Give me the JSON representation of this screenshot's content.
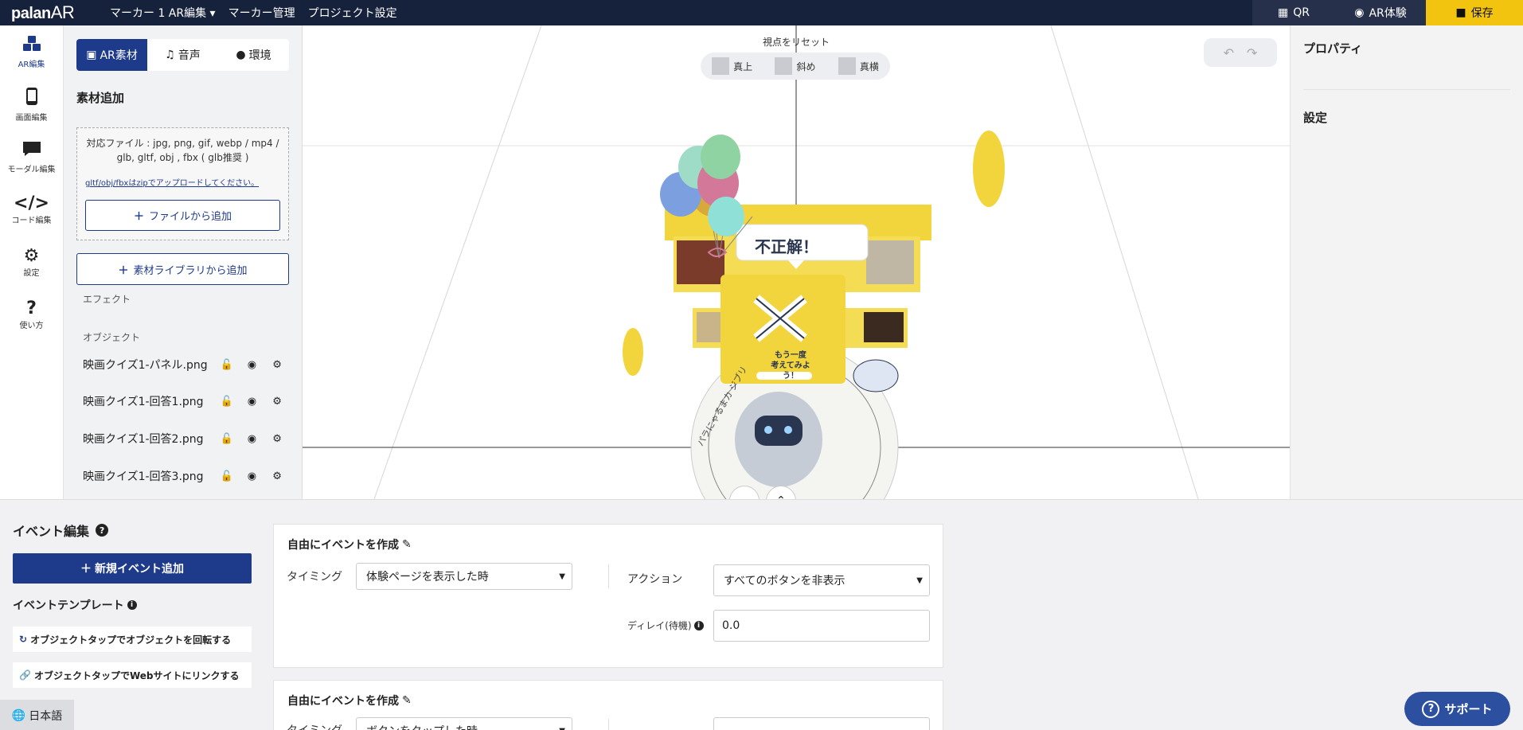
{
  "header": {
    "logo": "palan",
    "logo_ar": "AR",
    "nav": [
      "マーカー 1 AR編集 ▾",
      "マーカー管理",
      "プロジェクト設定"
    ],
    "qr_label": "QR",
    "ar_experience_label": "AR体験",
    "save_label": "保存"
  },
  "rail": {
    "items": [
      {
        "label": "AR編集",
        "icon": "cubes-icon"
      },
      {
        "label": "画面編集",
        "icon": "mobile-icon"
      },
      {
        "label": "モーダル編集",
        "icon": "comment-icon"
      },
      {
        "label": "コード編集",
        "icon": "code-icon"
      },
      {
        "label": "設定",
        "icon": "gear-icon"
      },
      {
        "label": "使い方",
        "icon": "question-icon"
      }
    ]
  },
  "panel": {
    "tabs": [
      {
        "label": "AR素材",
        "icon": "cubes-icon"
      },
      {
        "label": "音声",
        "icon": "music-icon"
      },
      {
        "label": "環境",
        "icon": "bulb-icon"
      }
    ],
    "title": "素材追加",
    "formats_line1": "対応ファイル : jpg, png, gif, webp / mp4 /",
    "formats_line2": "glb, gltf, obj , fbx ( glb推奨 )",
    "zip_note": "gltf/obj/fbxはzipでアップロードしてください。",
    "add_file": "ファイルから追加",
    "add_library": "素材ライブラリから追加",
    "effect_label": "エフェクト",
    "object_label": "オブジェクト",
    "objects": [
      "映画クイズ1-パネル.png",
      "映画クイズ1-回答1.png",
      "映画クイズ1-回答2.png",
      "映画クイズ1-回答3.png"
    ]
  },
  "viewport": {
    "reset": "視点をリセット",
    "views": [
      "真上",
      "斜め",
      "真横"
    ],
    "panel_text": "不正解！",
    "retry_text_1": "もう一度",
    "retry_text_2": "考えてみよう！",
    "circle_text": "パラにゃるまカ ジブリ"
  },
  "properties": {
    "title": "プロパティ",
    "settings": "設定"
  },
  "events": {
    "title": "イベント編集",
    "new_event": "新規イベント追加",
    "template_title": "イベントテンプレート",
    "templates": [
      "オブジェクトタップでオブジェクトを回転する",
      "オブジェクトタップでWebサイトにリンクする"
    ],
    "language": "日本語",
    "cards": [
      {
        "title": "自由にイベントを作成",
        "timing_label": "タイミング",
        "timing_value": "体験ページを表示した時",
        "action_label": "アクション",
        "action_value": "すべてのボタンを非表示",
        "delay_label": "ディレイ(待機)",
        "delay_value": "0.0"
      },
      {
        "title": "自由にイベントを作成",
        "timing_label": "タイミング",
        "timing_value": "ボタンをタップした時"
      }
    ]
  },
  "support": "サポート",
  "colors": {
    "header_bg": "#16213c",
    "accent": "#1e3a8a",
    "save": "#f2c40f",
    "support": "#2c4fa0"
  }
}
